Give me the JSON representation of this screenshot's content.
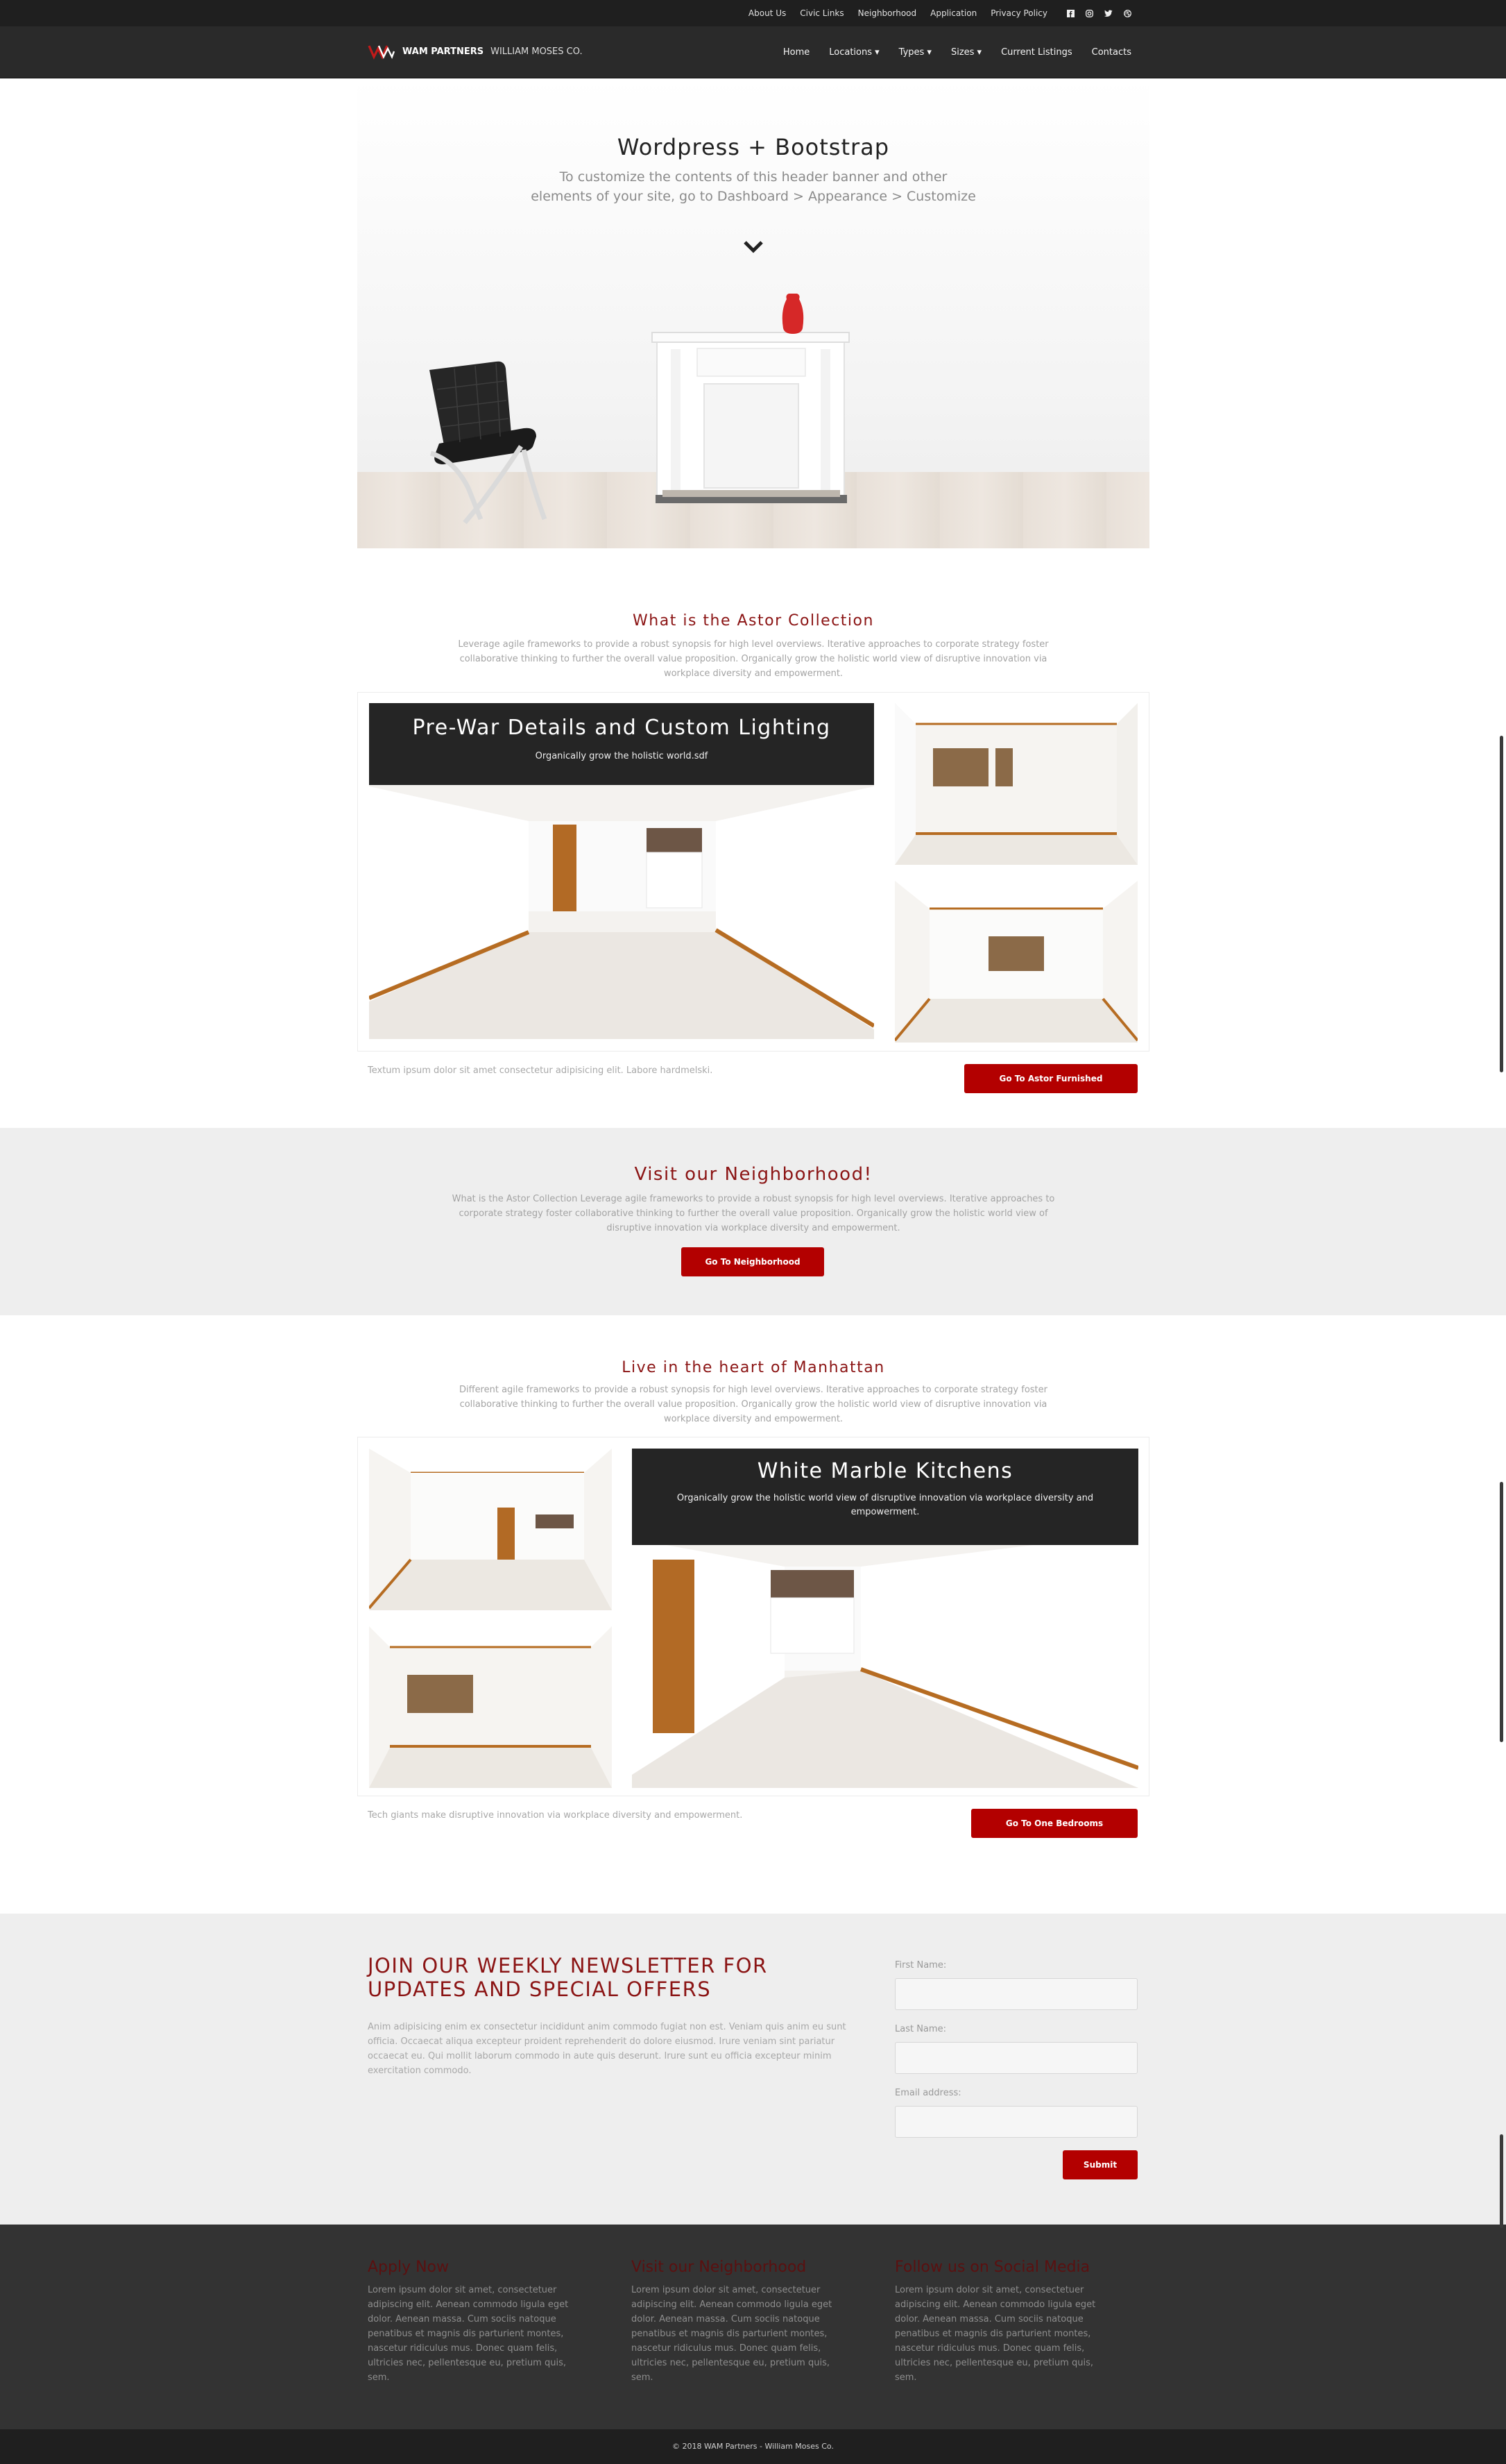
{
  "topbar": {
    "links": [
      "About Us",
      "Civic Links",
      "Neighborhood",
      "Application",
      "Privacy Policy"
    ],
    "social": [
      "facebook-icon",
      "instagram-icon",
      "twitter-icon",
      "dribbble-icon"
    ]
  },
  "nav": {
    "brand_name": "WAM PARTNERS",
    "brand_sub": "WILLIAM MOSES CO.",
    "items": [
      "Home",
      "Locations ▾",
      "Types ▾",
      "Sizes ▾",
      "Current Listings",
      "Contacts"
    ]
  },
  "hero": {
    "title": "Wordpress + Bootstrap",
    "subtitle": "To customize the contents of this header banner and other elements of your site, go to Dashboard > Appearance > Customize"
  },
  "astor": {
    "title": "What is the Astor Collection",
    "description": "Leverage agile frameworks to provide a robust synopsis for high level overviews. Iterative approaches to corporate strategy foster collaborative thinking to further the overall value proposition. Organically grow the holistic world view of disruptive innovation via workplace diversity and empowerment.",
    "caption_title": "Pre-War Details and Custom Lighting",
    "caption_text": "Organically grow the holistic world.sdf",
    "note": "Textum ipsum dolor sit amet consectetur adipisicing elit. Labore hardmelski.",
    "button": "Go To Astor Furnished"
  },
  "neighborhood": {
    "title": "Visit our Neighborhood!",
    "description": "What is the Astor Collection Leverage agile frameworks to provide a robust synopsis for high level overviews. Iterative approaches to corporate strategy foster collaborative thinking to further the overall value proposition. Organically grow the holistic world view of disruptive innovation via workplace diversity and empowerment.",
    "button": "Go To Neighborhood"
  },
  "manhattan": {
    "title": "Live in the heart of Manhattan",
    "description": "Different agile frameworks to provide a robust synopsis for high level overviews. Iterative approaches to corporate strategy foster collaborative thinking to further the overall value proposition. Organically grow the holistic world view of disruptive innovation via workplace diversity and empowerment.",
    "caption_title": "White Marble Kitchens",
    "caption_text": "Organically grow the holistic world view of disruptive innovation via workplace diversity and empowerment.",
    "note": "Tech giants make disruptive innovation via workplace diversity and empowerment.",
    "button": "Go To One Bedrooms"
  },
  "newsletter": {
    "title": "JOIN OUR WEEKLY NEWSLETTER FOR UPDATES AND SPECIAL OFFERS",
    "text": "Anim adipisicing enim ex consectetur incididunt anim commodo fugiat non est. Veniam quis anim eu sunt officia. Occaecat aliqua excepteur proident reprehenderit do dolore eiusmod. Irure veniam sint pariatur occaecat eu. Qui mollit laborum commodo in aute quis deserunt. Irure sunt eu officia excepteur minim exercitation commodo.",
    "first_name_label": "First Name:",
    "last_name_label": "Last Name:",
    "email_label": "Email address:",
    "first_name_value": "",
    "last_name_value": "",
    "email_value": "",
    "submit": "Submit"
  },
  "footer": {
    "columns": [
      {
        "title": "Apply Now",
        "text": "Lorem ipsum dolor sit amet, consectetuer adipiscing elit. Aenean commodo ligula eget dolor. Aenean massa. Cum sociis natoque penatibus et magnis dis parturient montes, nascetur ridiculus mus. Donec quam felis, ultricies nec, pellentesque eu, pretium quis, sem."
      },
      {
        "title": "Visit our Neighborhood",
        "text": "Lorem ipsum dolor sit amet, consectetuer adipiscing elit. Aenean commodo ligula eget dolor. Aenean massa. Cum sociis natoque penatibus et magnis dis parturient montes, nascetur ridiculus mus. Donec quam felis, ultricies nec, pellentesque eu, pretium quis, sem."
      },
      {
        "title": "Follow us on Social Media",
        "text": "Lorem ipsum dolor sit amet, consectetuer adipiscing elit. Aenean commodo ligula eget dolor. Aenean massa. Cum sociis natoque penatibus et magnis dis parturient montes, nascetur ridiculus mus. Donec quam felis, ultricies nec, pellentesque eu, pretium quis, sem."
      }
    ],
    "copyright": "© 2018 WAM Partners - William Moses Co."
  },
  "colors": {
    "accent": "#8b1414",
    "button": "#b30000",
    "dark": "#1f1f1f",
    "nav": "#2a2a2a",
    "band": "#eeeeee",
    "footer": "#333333"
  }
}
